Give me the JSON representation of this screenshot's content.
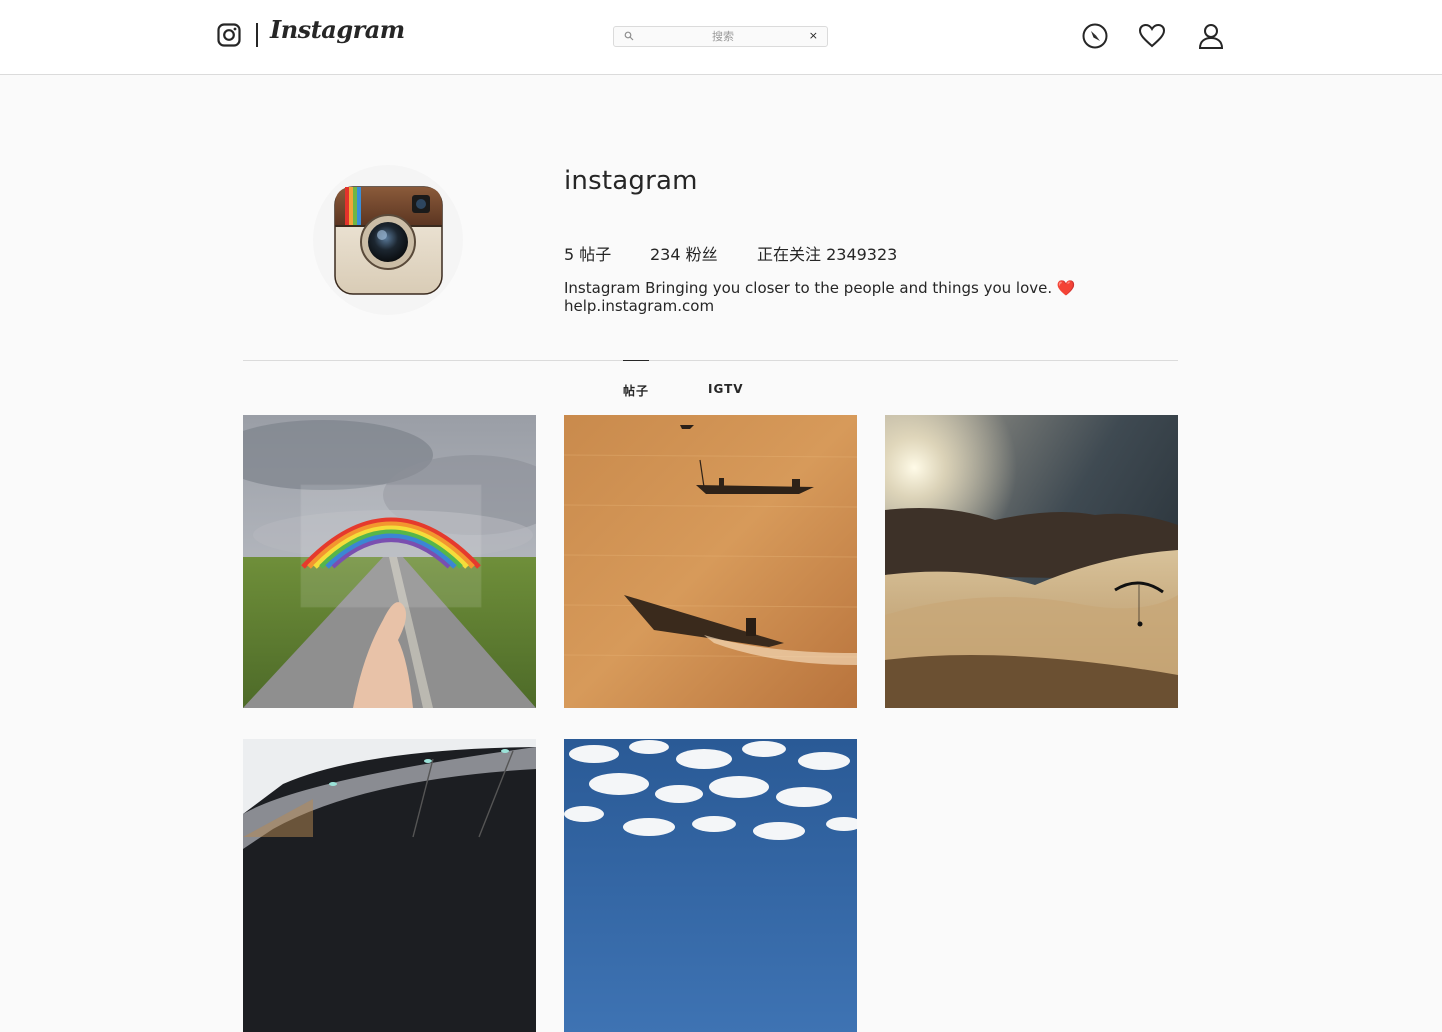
{
  "header": {
    "logo_text": "Instagram",
    "search_placeholder": "搜索",
    "search_clear": "×",
    "icons": [
      "instagram-glyph-icon",
      "compass-icon",
      "heart-icon",
      "user-icon"
    ]
  },
  "profile": {
    "username": "instagram",
    "stats": {
      "posts": "5 帖子",
      "followers": "234 粉丝",
      "following": "正在关注 2349323"
    },
    "bio_line1": "Instagram Bringing you closer to the people and things you love. ",
    "bio_heart": "❤️",
    "bio_line2": "help.instagram.com"
  },
  "tabs": [
    {
      "label": "帖子",
      "active": true
    },
    {
      "label": "IGTV",
      "active": false
    }
  ],
  "posts": [
    {
      "subject": "rainbow-road-photo"
    },
    {
      "subject": "boats-sunset-photo"
    },
    {
      "subject": "paraglider-fog-photo"
    },
    {
      "subject": "architecture-photo"
    },
    {
      "subject": "clouds-sky-photo"
    }
  ],
  "colors": {
    "background": "#fafafa",
    "border": "#dbdbdb",
    "text": "#262626",
    "heart": "#ed1c24"
  }
}
